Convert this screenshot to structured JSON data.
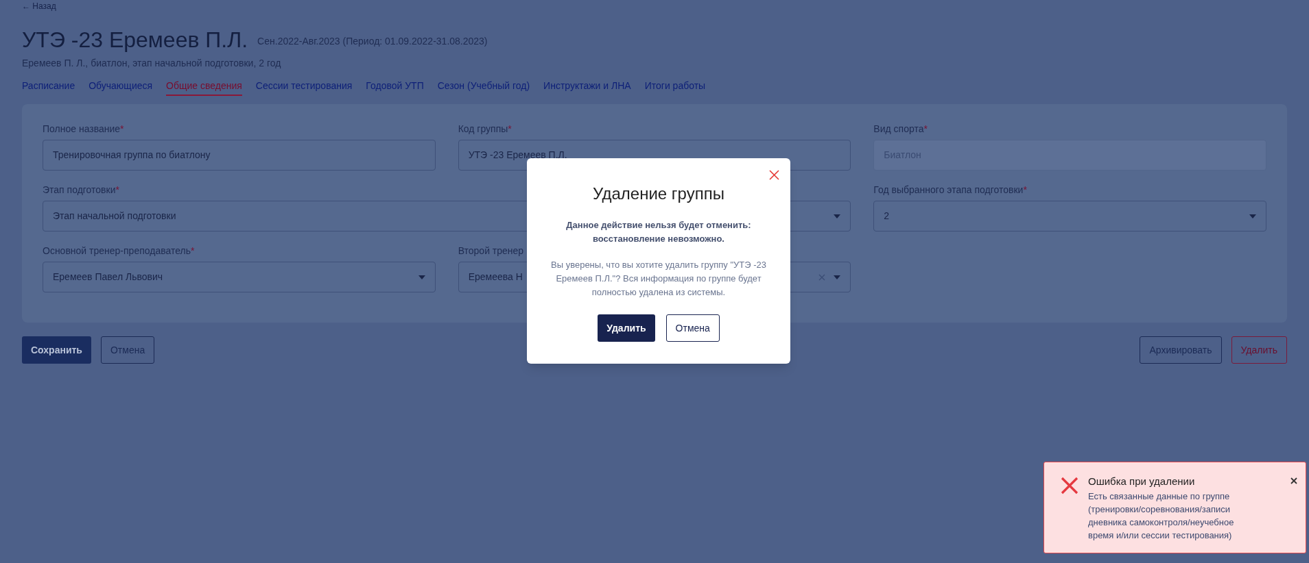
{
  "back_link": "← Назад",
  "title": "УТЭ -23 Еремеев П.Л.",
  "period": "Сен.2022-Авг.2023 (Период: 01.09.2022-31.08.2023)",
  "subtitle": "Еремеев П. Л., биатлон, этап начальной подготовки, 2 год",
  "tabs": [
    {
      "label": "Расписание",
      "selected": false
    },
    {
      "label": "Обучающиеся",
      "selected": false
    },
    {
      "label": "Общие сведения",
      "selected": true
    },
    {
      "label": "Сессии тестирования",
      "selected": false
    },
    {
      "label": "Годовой УТП",
      "selected": false
    },
    {
      "label": "Сезон (Учебный год)",
      "selected": false
    },
    {
      "label": "Инструктажи и ЛНА",
      "selected": false
    },
    {
      "label": "Итоги работы",
      "selected": false
    }
  ],
  "form": {
    "fields": [
      {
        "label": "Полное название",
        "mark": "*",
        "value": "Тренировочная группа по биатлону",
        "kind": "text",
        "wide": false,
        "clearable": false
      },
      {
        "label": "Код группы",
        "mark": "*",
        "value": "УТЭ -23 Еремеев П.Л.",
        "kind": "text",
        "wide": false,
        "clearable": false
      },
      {
        "label": "Вид спорта",
        "mark": "*",
        "value": "Биатлон",
        "kind": "disabled",
        "wide": false,
        "clearable": false
      },
      {
        "label": "Этап подготовки",
        "mark": "*",
        "value": "Этап начальной подготовки",
        "kind": "select",
        "wide": true,
        "clearable": false
      },
      {
        "label": "Год выбранного этапа подготовки",
        "mark": "*",
        "value": "2",
        "kind": "select",
        "wide": false,
        "clearable": false
      },
      {
        "label": "Основной тренер-преподаватель",
        "mark": "*",
        "value": "Еремеев Павел Львович",
        "kind": "select",
        "wide": false,
        "clearable": false
      },
      {
        "label": "Второй тренер",
        "value": "Еремеева Н",
        "kind": "select",
        "wide": false,
        "clearable": true
      }
    ]
  },
  "actions_left": [
    "Сохранить",
    "Отмена"
  ],
  "actions_right": [
    "Архивировать",
    "Удалить"
  ],
  "modal": {
    "title": "Удаление группы",
    "warning": "Данное действие нельзя будет отменить: восстановление невозможно.",
    "message": "Вы уверены, что вы хотите удалить группу \"УТЭ -23 Еремеев П.Л.\"? Вся информация по группе будет полностью удалена из системы.",
    "confirm": "Удалить",
    "cancel": "Отмена"
  },
  "toast": {
    "title": "Ошибка при удалении",
    "message": "Есть связанные данные по группе (тренировки/соревнования/записи дневника самоконтроля/неучебное время и/или сессии тестирования)"
  }
}
